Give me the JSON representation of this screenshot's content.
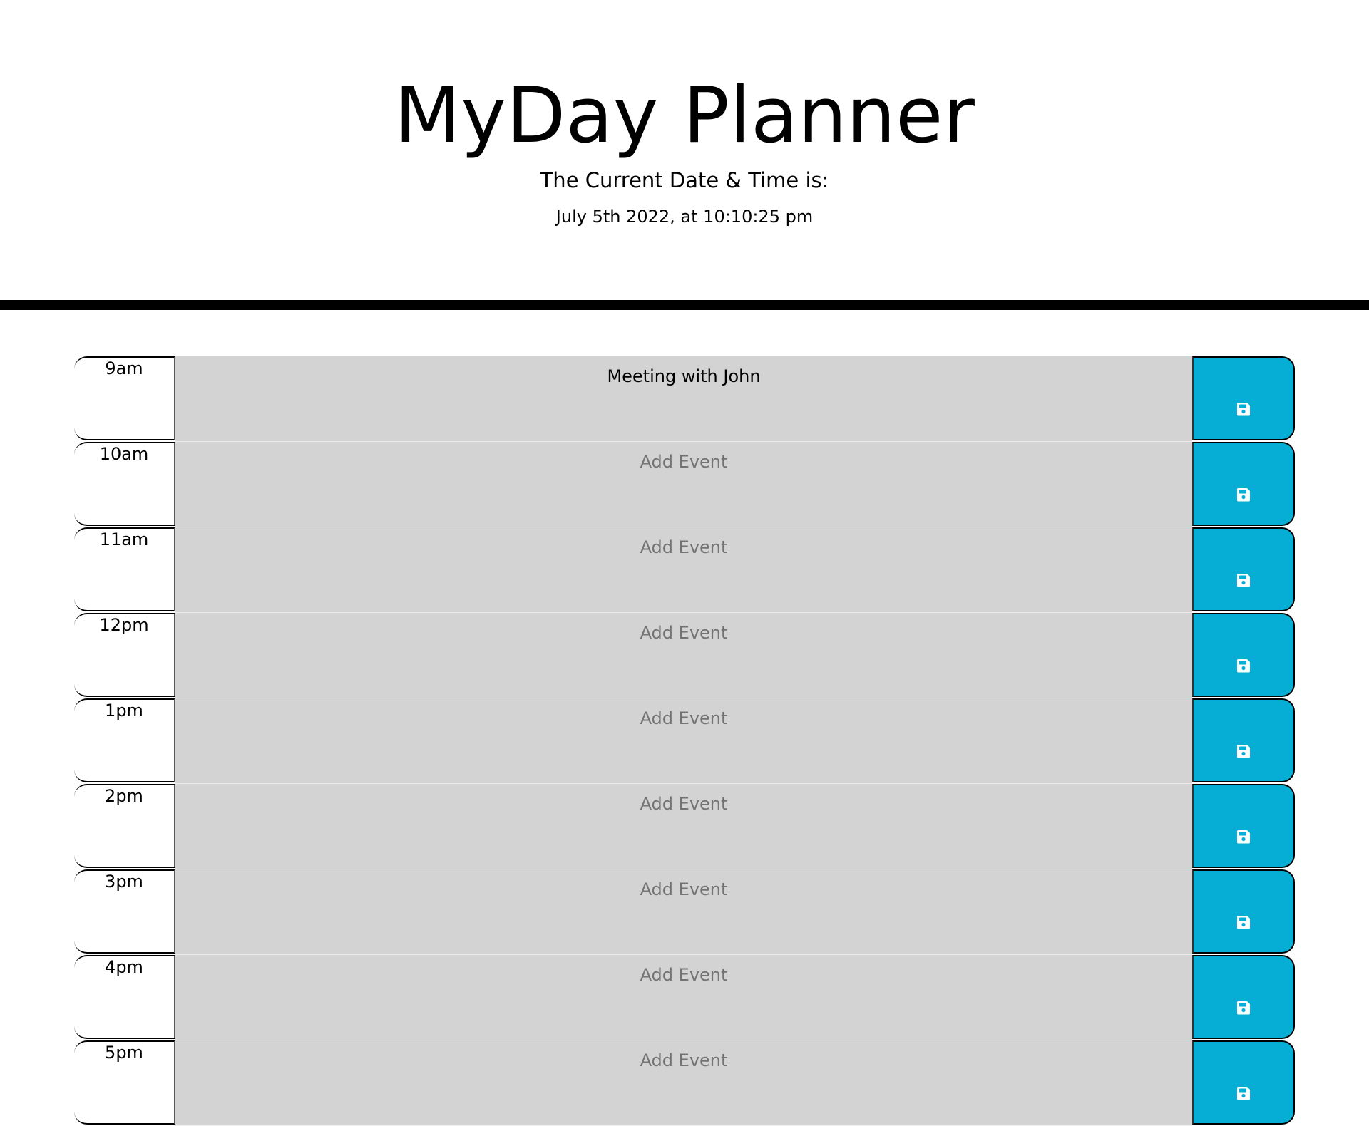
{
  "header": {
    "title": "MyDay Planner",
    "subtitle": "The Current Date & Time is:",
    "current_datetime": "July 5th 2022, at 10:10:25 pm"
  },
  "colors": {
    "save_button": "#06aed5",
    "row_background": "#d3d3d3"
  },
  "schedule": [
    {
      "hour": "9am",
      "event": "Meeting with John",
      "placeholder": "Add Event"
    },
    {
      "hour": "10am",
      "event": "",
      "placeholder": "Add Event"
    },
    {
      "hour": "11am",
      "event": "",
      "placeholder": "Add Event"
    },
    {
      "hour": "12pm",
      "event": "",
      "placeholder": "Add Event"
    },
    {
      "hour": "1pm",
      "event": "",
      "placeholder": "Add Event"
    },
    {
      "hour": "2pm",
      "event": "",
      "placeholder": "Add Event"
    },
    {
      "hour": "3pm",
      "event": "",
      "placeholder": "Add Event"
    },
    {
      "hour": "4pm",
      "event": "",
      "placeholder": "Add Event"
    },
    {
      "hour": "5pm",
      "event": "",
      "placeholder": "Add Event"
    }
  ],
  "icons": {
    "save": "save-icon"
  }
}
